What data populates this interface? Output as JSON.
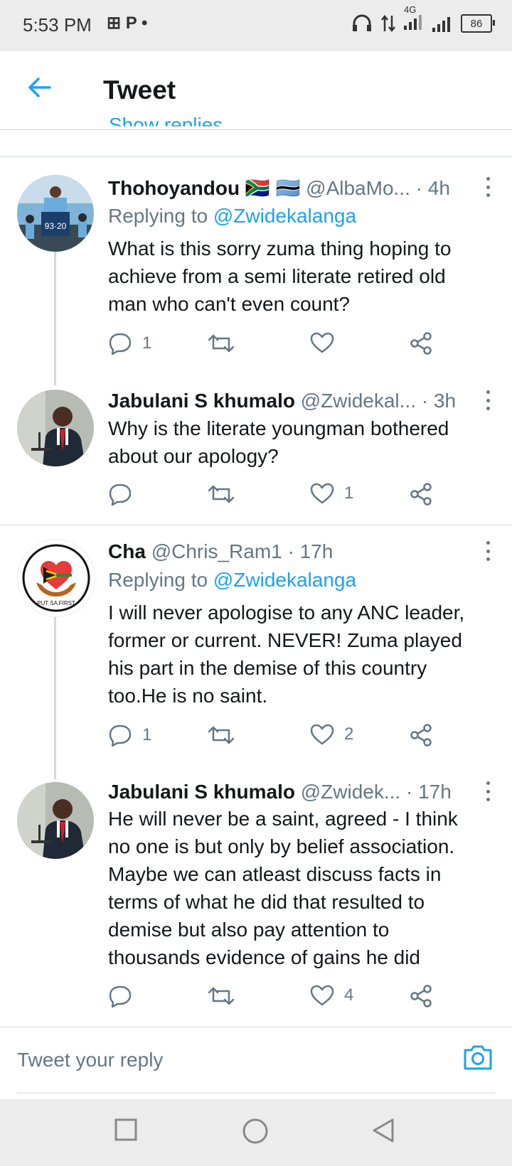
{
  "status_bar": {
    "time": "5:53 PM",
    "left_icons": "⊞ P •",
    "network": "4G",
    "battery": "86"
  },
  "header": {
    "title": "Tweet"
  },
  "partial_link": "Show replies",
  "tweets": [
    {
      "name": "Thohoyandou",
      "flags": "🇿🇦 🇧🇼",
      "handle": "@AlbaMo...",
      "time": "· 4h",
      "replying_prefix": "Replying to",
      "replying_handle": "@Zwidekalanga",
      "text": "What is this sorry zuma thing hoping to achieve from a semi literate retired old man who can't even count?",
      "reply_count": "1",
      "retweet_count": "",
      "like_count": ""
    },
    {
      "name": "Jabulani S khumalo",
      "handle": "@Zwidekal...",
      "time": "· 3h",
      "text": "Why is the literate youngman bothered about our apology?",
      "reply_count": "",
      "retweet_count": "",
      "like_count": "1"
    },
    {
      "name": "Cha",
      "handle": "@Chris_Ram1",
      "time": "· 17h",
      "replying_prefix": "Replying to",
      "replying_handle": "@Zwidekalanga",
      "text": "I will never apologise to any ANC leader, former or current. NEVER! Zuma played his part in the demise of this country too.He is no saint.",
      "reply_count": "1",
      "retweet_count": "",
      "like_count": "2"
    },
    {
      "name": "Jabulani S khumalo",
      "handle": "@Zwidek...",
      "time": "· 17h",
      "text": "He will never be a saint, agreed - I think no one is but only by belief association. Maybe we can atleast discuss facts in terms of what he did that resulted to demise but also pay attention to thousands evidence of gains he did",
      "reply_count": "",
      "retweet_count": "",
      "like_count": "4"
    }
  ],
  "reply_box": {
    "placeholder": "Tweet your reply"
  },
  "colors": {
    "accent": "#1da1f2",
    "muted": "#657786",
    "divider": "#cfd9de"
  }
}
